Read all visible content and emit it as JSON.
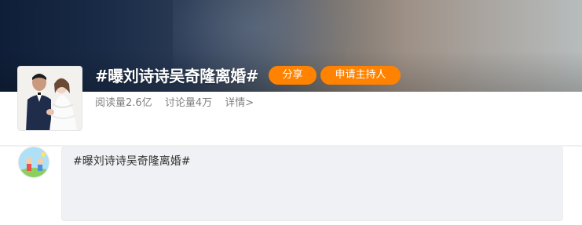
{
  "topic": {
    "title": "#曝刘诗诗吴奇隆离婚#",
    "stats": {
      "reads": "阅读量2.6亿",
      "discussions": "讨论量4万",
      "details": "详情>"
    },
    "cover_icon": "wedding-photo-image"
  },
  "actions": {
    "share_label": "分享",
    "host_label": "申请主持人"
  },
  "composer": {
    "avatar_icon": "user-avatar-image",
    "text": "#曝刘诗诗吴奇隆离婚#"
  },
  "colors": {
    "accent": "#ff8200",
    "composer_bg": "#f0f1f4",
    "stats_text": "#808080"
  }
}
